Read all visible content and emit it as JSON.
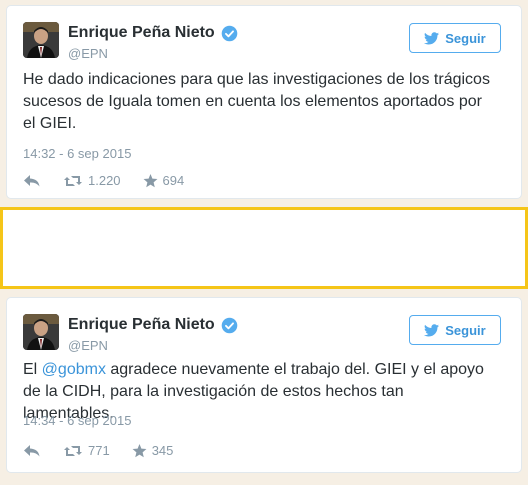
{
  "colors": {
    "accent": "#55acee",
    "highlight_border": "#f5c518",
    "page_bg": "#f6efe4"
  },
  "tweets": [
    {
      "display_name": "Enrique Peña Nieto",
      "handle": "@EPN",
      "follow_label": "Seguir",
      "text": "He dado indicaciones para que las investigaciones de los trágicos sucesos de Iguala tomen en cuenta los elementos aportados por el GIEI.",
      "timestamp": "14:32 - 6 sep 2015",
      "retweets": "1.220",
      "likes": "694",
      "icons": [
        "verified-badge-icon",
        "twitter-bird-icon",
        "reply-icon",
        "retweet-icon",
        "star-icon"
      ]
    },
    {
      "display_name": "Enrique Peña Nieto",
      "handle": "@EPN",
      "follow_label": "Seguir",
      "text_before": "El ",
      "mention": "@gobmx",
      "text_after": " agradece nuevamente el trabajo del. GIEI y el apoyo de la CIDH, para la investigación de estos hechos tan lamentables.",
      "timestamp": "14:34 - 6 sep 2015",
      "retweets": "771",
      "likes": "345",
      "icons": [
        "verified-badge-icon",
        "twitter-bird-icon",
        "reply-icon",
        "retweet-icon",
        "star-icon"
      ]
    }
  ]
}
